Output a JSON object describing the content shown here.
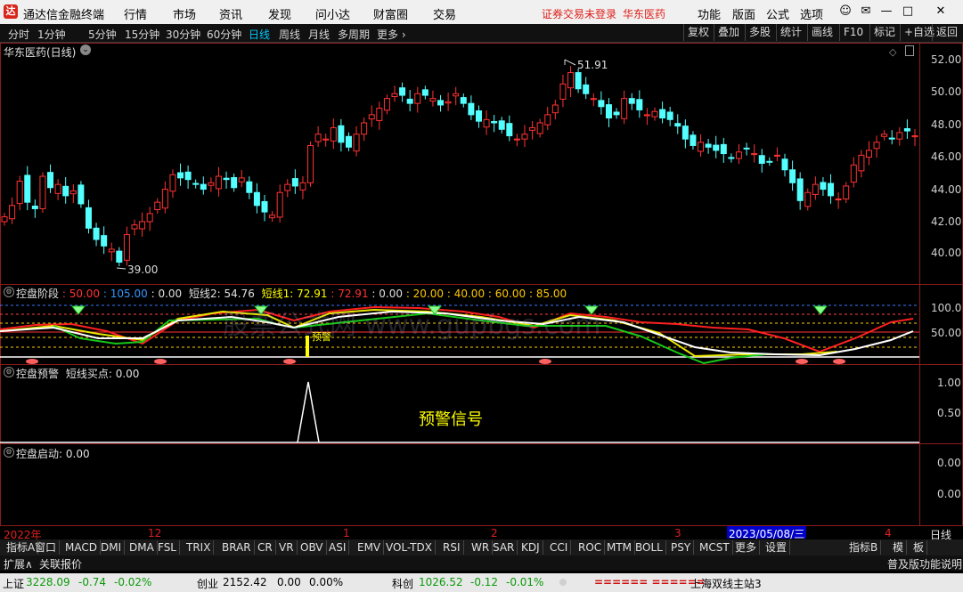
{
  "titlebar": {
    "app_name": "通达信金融终端",
    "menus": [
      "行情",
      "市场",
      "资讯",
      "发现",
      "问小达",
      "财富圈",
      "交易"
    ],
    "notice": "证券交易未登录",
    "stock": "华东医药",
    "right_menus": [
      "功能",
      "版面",
      "公式",
      "选项"
    ]
  },
  "periods": [
    "分时",
    "1分钟",
    "5分钟",
    "15分钟",
    "30分钟",
    "60分钟",
    "日线",
    "周线",
    "月线",
    "多周期",
    "更多 ›"
  ],
  "active_period": "日线",
  "right_buttons": [
    "复权",
    "叠加",
    "多股",
    "统计",
    "画线",
    "F10",
    "标记",
    "+自选",
    "返回"
  ],
  "main_panel": {
    "title": "华东医药(日线)",
    "y_labels": [
      "52.00",
      "50.00",
      "48.00",
      "46.00",
      "44.00",
      "42.00",
      "40.00"
    ],
    "high_label": "51.91",
    "low_label": "39.00"
  },
  "ind1": {
    "name": "控盘阶段",
    "values": [
      "50.00",
      "105.00",
      "0.00"
    ],
    "short2_label": "短线2: 54.76",
    "short1_label": "短线1: 72.91",
    "rest": [
      "72.91",
      "0.00",
      "20.00",
      "40.00",
      "60.00",
      "85.00"
    ],
    "y_labels": [
      "100.0",
      "50.00"
    ],
    "marker": "预警"
  },
  "ind2": {
    "name": "控盘预警",
    "sub": "短线买点: 0.00",
    "y_labels": [
      "1.00",
      "0.50"
    ],
    "signal_text": "预警信号"
  },
  "ind3": {
    "name": "控盘启动",
    "value": ": 0.00",
    "y_labels": [
      "0.00",
      "0.00"
    ]
  },
  "watermark": "股票公式网 www.gupbgs.com",
  "timeline": {
    "labels": [
      "2022年",
      "12",
      "1",
      "2",
      "3",
      "4"
    ],
    "highlight": "2023/05/08/三",
    "right": "日线"
  },
  "bottom_tabs": [
    "指标A",
    "窗口",
    "MACD",
    "DMI",
    "DMA",
    "FSL",
    "TRIX",
    "BRAR",
    "CR",
    "VR",
    "OBV",
    "ASI",
    "EMV",
    "VOL-TDX",
    "RSI",
    "WR",
    "SAR",
    "KDJ",
    "CCI",
    "ROC",
    "MTM",
    "BOLL",
    "PSY",
    "MCST",
    "更多",
    "设置"
  ],
  "bottom_right_tabs": [
    "指标B",
    "模",
    "板"
  ],
  "row2": {
    "left": [
      "扩展∧",
      "关联报价"
    ],
    "right": "普及版功能说明"
  },
  "statusbar": {
    "sh_name": "上证",
    "sh_val": "3228.09",
    "sh_chg": "-0.74",
    "sh_pct": "-0.02%",
    "cy_name": "创业",
    "cy_val": "2152.42",
    "cy_chg": "0.00",
    "cy_pct": "0.00%",
    "kc_name": "科创",
    "kc_val": "1026.52",
    "kc_chg": "-0.12",
    "kc_pct": "-0.01%",
    "dashes": "====== ======",
    "site": "上海双线主站3"
  },
  "colors": {
    "up": "#ff3232",
    "down": "#54ffff",
    "frame": "#8b1c1c",
    "highlight": "#0000c8"
  }
}
